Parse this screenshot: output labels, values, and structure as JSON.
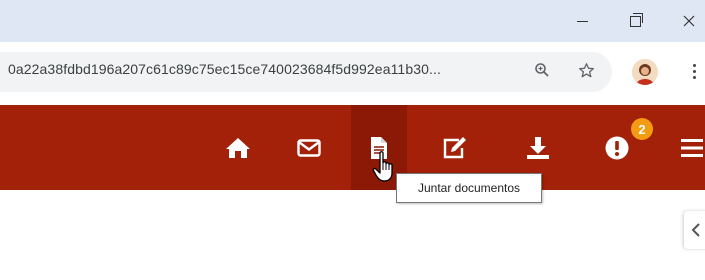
{
  "browser": {
    "url": "0a22a38fdbd196a207c61c89c75ec15ce740023684f5d992ea11b30...",
    "window_controls": [
      "minimize",
      "maximize",
      "close"
    ],
    "icons": [
      "zoom-icon",
      "bookmark-star-icon",
      "profile-avatar",
      "kebab-menu-icon"
    ]
  },
  "toolbar": {
    "background": "#a32108",
    "active_background": "#8c1906",
    "buttons": [
      {
        "name": "home",
        "icon": "home-icon"
      },
      {
        "name": "messages",
        "icon": "envelope-icon"
      },
      {
        "name": "attach-documents",
        "icon": "document-attach-icon",
        "active": true
      },
      {
        "name": "edit",
        "icon": "edit-icon"
      },
      {
        "name": "download",
        "icon": "download-icon"
      },
      {
        "name": "notifications",
        "icon": "exclamation-icon",
        "badge": "2"
      },
      {
        "name": "menu",
        "icon": "hamburger-menu-icon"
      }
    ],
    "notification_badge": "2",
    "badge_color": "#f39c12"
  },
  "tooltip": {
    "text": "Juntar documentos"
  }
}
